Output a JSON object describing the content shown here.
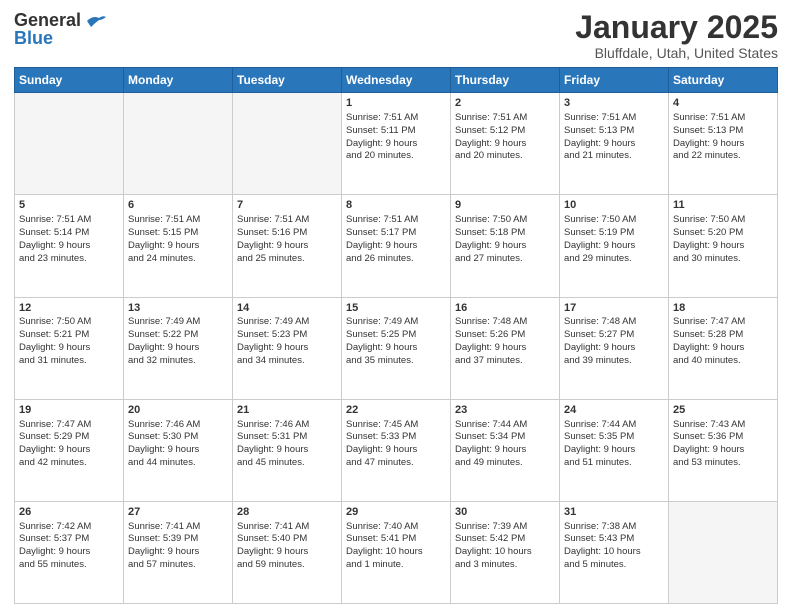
{
  "header": {
    "logo_line1": "General",
    "logo_line2": "Blue",
    "month": "January 2025",
    "location": "Bluffdale, Utah, United States"
  },
  "weekdays": [
    "Sunday",
    "Monday",
    "Tuesday",
    "Wednesday",
    "Thursday",
    "Friday",
    "Saturday"
  ],
  "weeks": [
    [
      {
        "day": "",
        "info": ""
      },
      {
        "day": "",
        "info": ""
      },
      {
        "day": "",
        "info": ""
      },
      {
        "day": "1",
        "info": "Sunrise: 7:51 AM\nSunset: 5:11 PM\nDaylight: 9 hours\nand 20 minutes."
      },
      {
        "day": "2",
        "info": "Sunrise: 7:51 AM\nSunset: 5:12 PM\nDaylight: 9 hours\nand 20 minutes."
      },
      {
        "day": "3",
        "info": "Sunrise: 7:51 AM\nSunset: 5:13 PM\nDaylight: 9 hours\nand 21 minutes."
      },
      {
        "day": "4",
        "info": "Sunrise: 7:51 AM\nSunset: 5:13 PM\nDaylight: 9 hours\nand 22 minutes."
      }
    ],
    [
      {
        "day": "5",
        "info": "Sunrise: 7:51 AM\nSunset: 5:14 PM\nDaylight: 9 hours\nand 23 minutes."
      },
      {
        "day": "6",
        "info": "Sunrise: 7:51 AM\nSunset: 5:15 PM\nDaylight: 9 hours\nand 24 minutes."
      },
      {
        "day": "7",
        "info": "Sunrise: 7:51 AM\nSunset: 5:16 PM\nDaylight: 9 hours\nand 25 minutes."
      },
      {
        "day": "8",
        "info": "Sunrise: 7:51 AM\nSunset: 5:17 PM\nDaylight: 9 hours\nand 26 minutes."
      },
      {
        "day": "9",
        "info": "Sunrise: 7:50 AM\nSunset: 5:18 PM\nDaylight: 9 hours\nand 27 minutes."
      },
      {
        "day": "10",
        "info": "Sunrise: 7:50 AM\nSunset: 5:19 PM\nDaylight: 9 hours\nand 29 minutes."
      },
      {
        "day": "11",
        "info": "Sunrise: 7:50 AM\nSunset: 5:20 PM\nDaylight: 9 hours\nand 30 minutes."
      }
    ],
    [
      {
        "day": "12",
        "info": "Sunrise: 7:50 AM\nSunset: 5:21 PM\nDaylight: 9 hours\nand 31 minutes."
      },
      {
        "day": "13",
        "info": "Sunrise: 7:49 AM\nSunset: 5:22 PM\nDaylight: 9 hours\nand 32 minutes."
      },
      {
        "day": "14",
        "info": "Sunrise: 7:49 AM\nSunset: 5:23 PM\nDaylight: 9 hours\nand 34 minutes."
      },
      {
        "day": "15",
        "info": "Sunrise: 7:49 AM\nSunset: 5:25 PM\nDaylight: 9 hours\nand 35 minutes."
      },
      {
        "day": "16",
        "info": "Sunrise: 7:48 AM\nSunset: 5:26 PM\nDaylight: 9 hours\nand 37 minutes."
      },
      {
        "day": "17",
        "info": "Sunrise: 7:48 AM\nSunset: 5:27 PM\nDaylight: 9 hours\nand 39 minutes."
      },
      {
        "day": "18",
        "info": "Sunrise: 7:47 AM\nSunset: 5:28 PM\nDaylight: 9 hours\nand 40 minutes."
      }
    ],
    [
      {
        "day": "19",
        "info": "Sunrise: 7:47 AM\nSunset: 5:29 PM\nDaylight: 9 hours\nand 42 minutes."
      },
      {
        "day": "20",
        "info": "Sunrise: 7:46 AM\nSunset: 5:30 PM\nDaylight: 9 hours\nand 44 minutes."
      },
      {
        "day": "21",
        "info": "Sunrise: 7:46 AM\nSunset: 5:31 PM\nDaylight: 9 hours\nand 45 minutes."
      },
      {
        "day": "22",
        "info": "Sunrise: 7:45 AM\nSunset: 5:33 PM\nDaylight: 9 hours\nand 47 minutes."
      },
      {
        "day": "23",
        "info": "Sunrise: 7:44 AM\nSunset: 5:34 PM\nDaylight: 9 hours\nand 49 minutes."
      },
      {
        "day": "24",
        "info": "Sunrise: 7:44 AM\nSunset: 5:35 PM\nDaylight: 9 hours\nand 51 minutes."
      },
      {
        "day": "25",
        "info": "Sunrise: 7:43 AM\nSunset: 5:36 PM\nDaylight: 9 hours\nand 53 minutes."
      }
    ],
    [
      {
        "day": "26",
        "info": "Sunrise: 7:42 AM\nSunset: 5:37 PM\nDaylight: 9 hours\nand 55 minutes."
      },
      {
        "day": "27",
        "info": "Sunrise: 7:41 AM\nSunset: 5:39 PM\nDaylight: 9 hours\nand 57 minutes."
      },
      {
        "day": "28",
        "info": "Sunrise: 7:41 AM\nSunset: 5:40 PM\nDaylight: 9 hours\nand 59 minutes."
      },
      {
        "day": "29",
        "info": "Sunrise: 7:40 AM\nSunset: 5:41 PM\nDaylight: 10 hours\nand 1 minute."
      },
      {
        "day": "30",
        "info": "Sunrise: 7:39 AM\nSunset: 5:42 PM\nDaylight: 10 hours\nand 3 minutes."
      },
      {
        "day": "31",
        "info": "Sunrise: 7:38 AM\nSunset: 5:43 PM\nDaylight: 10 hours\nand 5 minutes."
      },
      {
        "day": "",
        "info": ""
      }
    ]
  ]
}
